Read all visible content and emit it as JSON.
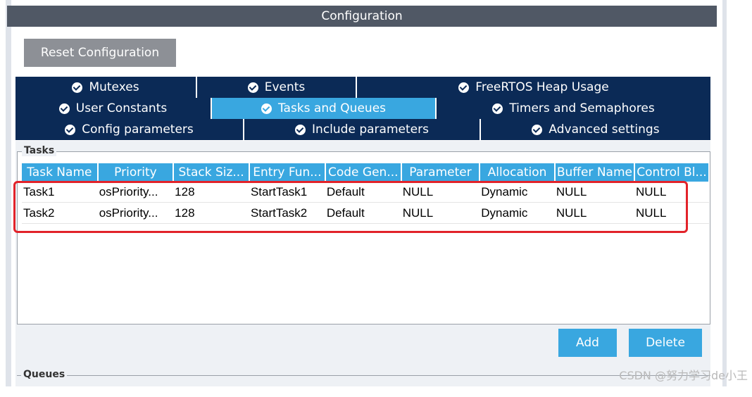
{
  "title": "Configuration",
  "reset_button": "Reset Configuration",
  "tab_rows": [
    [
      {
        "label": "Mutexes",
        "active": false
      },
      {
        "label": "Events",
        "active": false
      },
      {
        "label": "FreeRTOS Heap Usage",
        "active": false
      }
    ],
    [
      {
        "label": "User Constants",
        "active": false
      },
      {
        "label": "Tasks and Queues",
        "active": true
      },
      {
        "label": "Timers and Semaphores",
        "active": false
      }
    ],
    [
      {
        "label": "Config parameters",
        "active": false
      },
      {
        "label": "Include parameters",
        "active": false
      },
      {
        "label": "Advanced settings",
        "active": false
      }
    ]
  ],
  "tasks_group": {
    "legend": "Tasks",
    "columns": [
      "Task Name",
      "Priority",
      "Stack Siz...",
      "Entry Fun...",
      "Code Gen...",
      "Parameter",
      "Allocation",
      "Buffer Name",
      "Control Bl..."
    ],
    "rows": [
      [
        "Task1",
        "osPriority...",
        "128",
        "StartTask1",
        "Default",
        "NULL",
        "Dynamic",
        "NULL",
        "NULL"
      ],
      [
        "Task2",
        "osPriority...",
        "128",
        "StartTask2",
        "Default",
        "NULL",
        "Dynamic",
        "NULL",
        "NULL"
      ]
    ],
    "add_label": "Add",
    "delete_label": "Delete"
  },
  "queues_group": {
    "legend": "Queues"
  },
  "watermark": "CSDN @努力学习de小王",
  "colors": {
    "header_dark": "#505865",
    "tab_dark": "#0b2a56",
    "accent_blue": "#39a7e0",
    "highlight_red": "#e2232a"
  }
}
